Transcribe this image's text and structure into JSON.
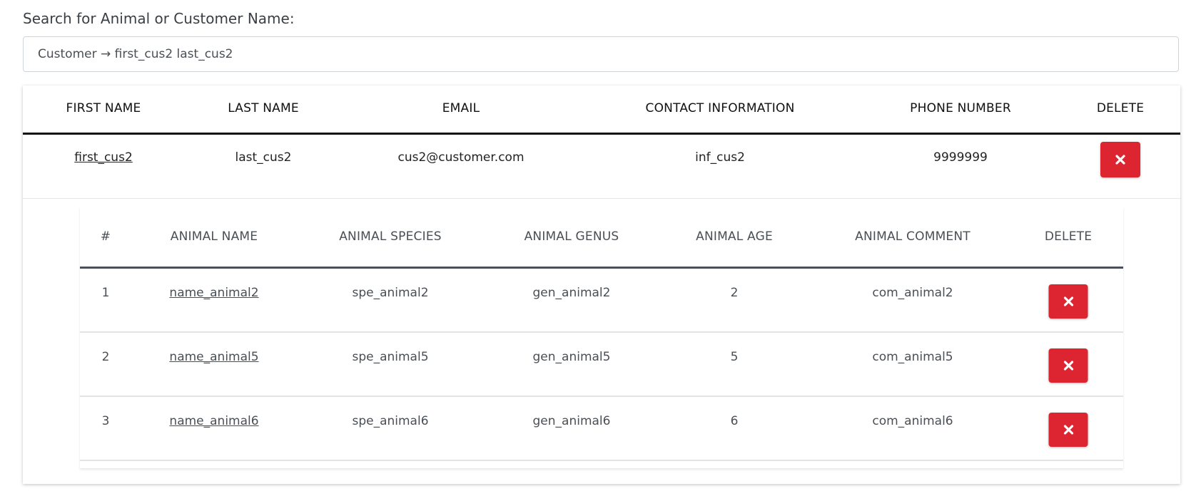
{
  "search": {
    "label": "Search for Animal or Customer Name:",
    "value": "Customer → first_cus2 last_cus2"
  },
  "customer_table": {
    "headers": [
      "FIRST NAME",
      "LAST NAME",
      "EMAIL",
      "CONTACT INFORMATION",
      "PHONE NUMBER",
      "DELETE"
    ],
    "rows": [
      {
        "first_name": "first_cus2",
        "last_name": "last_cus2",
        "email": "cus2@customer.com",
        "contact": "inf_cus2",
        "phone": "9999999"
      }
    ]
  },
  "animal_table": {
    "headers": [
      "#",
      "ANIMAL NAME",
      "ANIMAL SPECIES",
      "ANIMAL GENUS",
      "ANIMAL AGE",
      "ANIMAL COMMENT",
      "DELETE"
    ],
    "rows": [
      {
        "num": "1",
        "name": "name_animal2",
        "species": "spe_animal2",
        "genus": "gen_animal2",
        "age": "2",
        "comment": "com_animal2"
      },
      {
        "num": "2",
        "name": "name_animal5",
        "species": "spe_animal5",
        "genus": "gen_animal5",
        "age": "5",
        "comment": "com_animal5"
      },
      {
        "num": "3",
        "name": "name_animal6",
        "species": "spe_animal6",
        "genus": "gen_animal6",
        "age": "6",
        "comment": "com_animal6"
      }
    ]
  },
  "icons": {
    "delete": "close-icon"
  },
  "colors": {
    "danger": "#dc2530",
    "link": "#3f64c3"
  }
}
